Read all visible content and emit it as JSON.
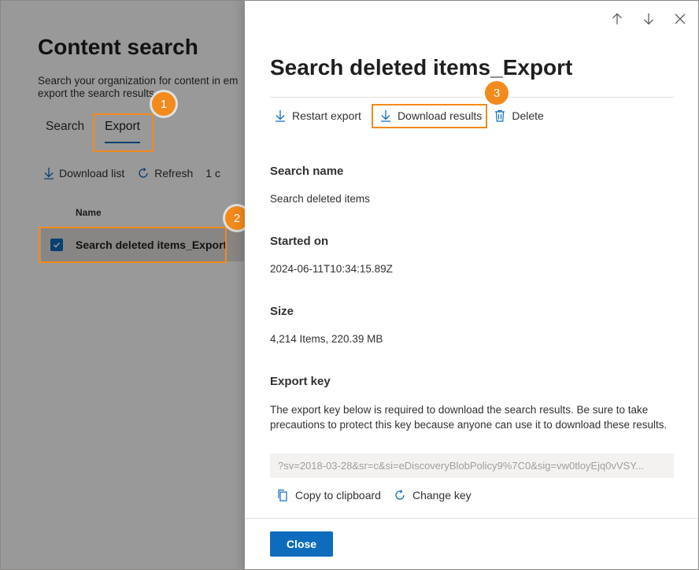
{
  "background": {
    "title": "Content search",
    "description_line1": "Search your organization for content in em",
    "description_line2": "export the search results",
    "tabs": [
      {
        "label": "Search",
        "active": false
      },
      {
        "label": "Export",
        "active": true
      }
    ],
    "toolbar": {
      "download_list": "Download list",
      "refresh": "Refresh",
      "count_partial": "1 c"
    },
    "column_header": "Name",
    "selected_row": "Search deleted items_Export"
  },
  "callouts": [
    "1",
    "2",
    "3"
  ],
  "panel": {
    "title": "Search deleted items_Export",
    "actions": {
      "restart": "Restart export",
      "download": "Download results",
      "delete": "Delete"
    },
    "search_name_label": "Search name",
    "search_name_value": "Search deleted items",
    "started_on_label": "Started on",
    "started_on_value": "2024-06-11T10:34:15.89Z",
    "size_label": "Size",
    "size_value": "4,214 Items, 220.39 MB",
    "export_key_label": "Export key",
    "export_key_desc": "The export key below is required to download the search results. Be sure to take precautions to protect this key because anyone can use it to download these results.",
    "export_key_value": "?sv=2018-03-28&sr=c&si=eDiscoveryBlobPolicy9%7C0&sig=vw0tloyEjq0vVSY...",
    "copy_to_clipboard": "Copy to clipboard",
    "change_key": "Change key",
    "close": "Close"
  },
  "colors": {
    "accent": "#0f6cbd",
    "callout": "#f28a1c"
  }
}
